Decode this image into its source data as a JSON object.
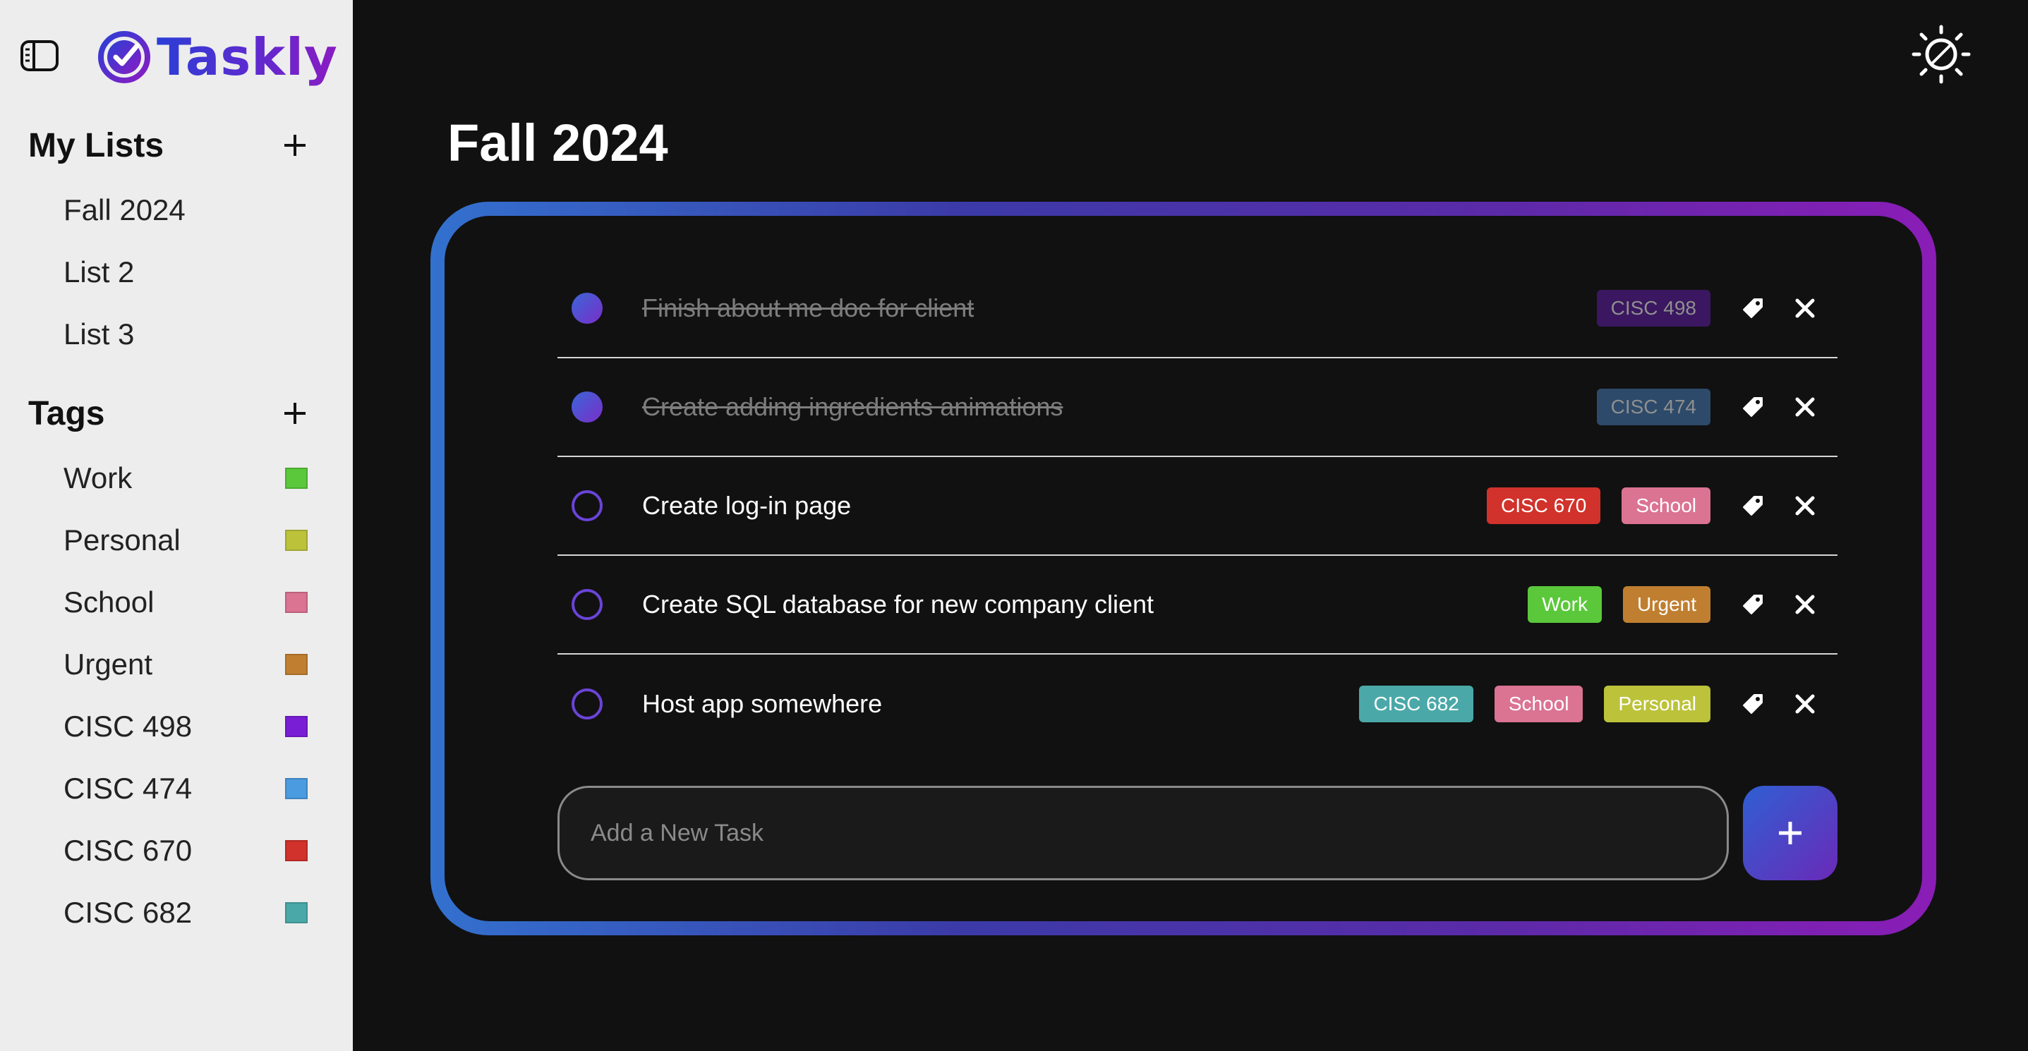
{
  "app": {
    "name": "Taskly"
  },
  "sidebar": {
    "lists_title": "My Lists",
    "lists": [
      {
        "label": "Fall 2024"
      },
      {
        "label": "List 2"
      },
      {
        "label": "List 3"
      }
    ],
    "tags_title": "Tags",
    "tags": [
      {
        "label": "Work",
        "color": "#5ac83a"
      },
      {
        "label": "Personal",
        "color": "#bcc23a"
      },
      {
        "label": "School",
        "color": "#db7393"
      },
      {
        "label": "Urgent",
        "color": "#c07f30"
      },
      {
        "label": "CISC 498",
        "color": "#7a1ed6"
      },
      {
        "label": "CISC 474",
        "color": "#4a9be0"
      },
      {
        "label": "CISC 670",
        "color": "#d1322b"
      },
      {
        "label": "CISC 682",
        "color": "#4ba8a8"
      }
    ]
  },
  "main": {
    "title": "Fall 2024",
    "tasks": [
      {
        "text": "Finish about me doc for client",
        "completed": true,
        "tags": [
          {
            "label": "CISC 498",
            "color": "#3a1760"
          }
        ]
      },
      {
        "text": "Create adding ingredients animations",
        "completed": true,
        "tags": [
          {
            "label": "CISC 474",
            "color": "#2d4a6a"
          }
        ]
      },
      {
        "text": "Create log-in page",
        "completed": false,
        "tags": [
          {
            "label": "CISC 670",
            "color": "#d1322b"
          },
          {
            "label": "School",
            "color": "#db7393"
          }
        ]
      },
      {
        "text": "Create SQL database for new company client",
        "completed": false,
        "tags": [
          {
            "label": "Work",
            "color": "#5ac83a"
          },
          {
            "label": "Urgent",
            "color": "#c07f30"
          }
        ]
      },
      {
        "text": "Host app somewhere",
        "completed": false,
        "tags": [
          {
            "label": "CISC 682",
            "color": "#4ba8a8"
          },
          {
            "label": "School",
            "color": "#db7393"
          },
          {
            "label": "Personal",
            "color": "#bcc23a"
          }
        ]
      }
    ],
    "new_task_placeholder": "Add a New Task"
  },
  "icons": {
    "sidebar_toggle": "sidebar-toggle-icon",
    "theme": "sun-icon",
    "add": "plus-icon",
    "tag": "tag-icon",
    "delete": "close-icon"
  }
}
